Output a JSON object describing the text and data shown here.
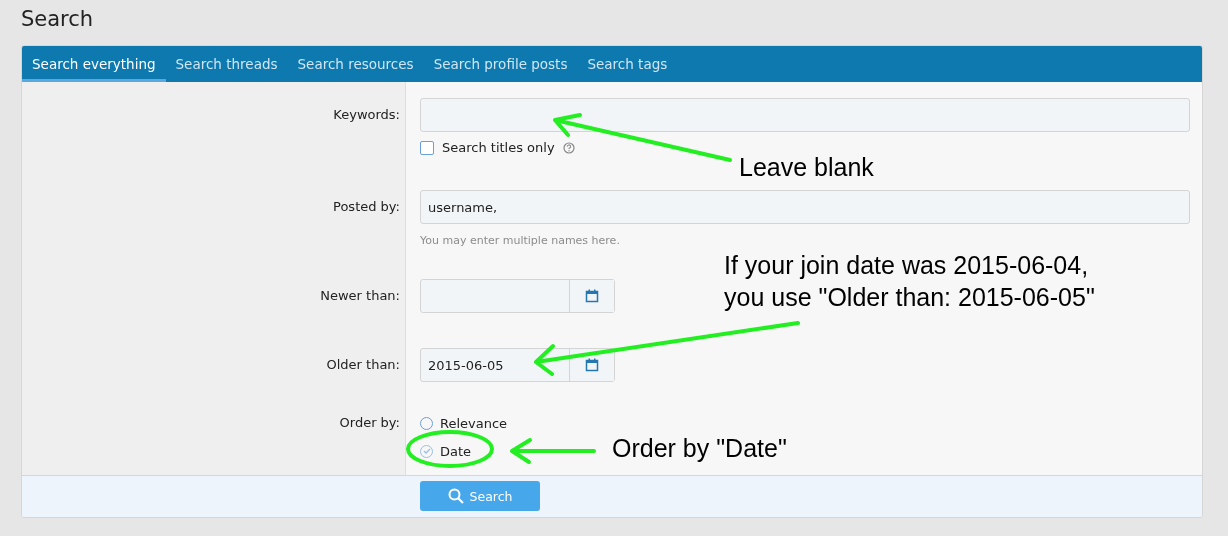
{
  "page_title": "Search",
  "tabs": [
    {
      "label": "Search everything",
      "selected": true
    },
    {
      "label": "Search threads",
      "selected": false
    },
    {
      "label": "Search resources",
      "selected": false
    },
    {
      "label": "Search profile posts",
      "selected": false
    },
    {
      "label": "Search tags",
      "selected": false
    }
  ],
  "fields": [
    {
      "kind": "text",
      "label": "Keywords:",
      "checkbox": {
        "label": "Search titles only",
        "checked": false
      }
    },
    {
      "kind": "text",
      "label": "Posted by:",
      "value": "username,",
      "hint": "You may enter multiple names here."
    },
    {
      "kind": "date",
      "label": "Newer than:"
    },
    {
      "kind": "date",
      "label": "Older than:",
      "value": "2015-06-05"
    },
    {
      "kind": "radio",
      "label": "Order by:",
      "options": [
        {
          "label": "Relevance",
          "selected": false
        },
        {
          "label": "Date",
          "selected": true
        }
      ]
    }
  ],
  "submit": "Search",
  "annotations": [
    {
      "lines": [
        "Leave blank"
      ]
    },
    {
      "lines": [
        "If your join date was 2015-06-04,",
        "you use \"Older than: 2015-06-05\""
      ]
    },
    {
      "lines": [
        "Order by \"Date\""
      ]
    }
  ]
}
